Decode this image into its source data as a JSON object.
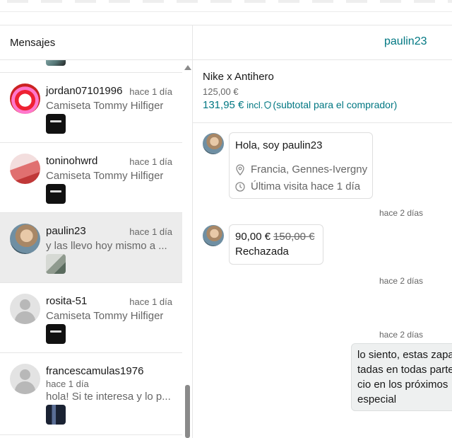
{
  "left_panel": {
    "title": "Mensajes",
    "conversations": [
      {
        "username": "jordan07101996",
        "time": "hace 1 día",
        "preview": "Camiseta Tommy Hilfiger",
        "avatar": "red-avatar",
        "thumb": "tshirt-thumb"
      },
      {
        "username": "toninohwrd",
        "time": "hace 1 día",
        "preview": "Camiseta Tommy Hilfiger",
        "avatar": "pink-avatar",
        "thumb": "tshirt-thumb"
      },
      {
        "username": "paulin23",
        "time": "hace 1 día",
        "preview": "y las llevo hoy mismo a ...",
        "avatar": "photo-avatar",
        "thumb": "shoes-thumb",
        "active": true
      },
      {
        "username": "rosita-51",
        "time": "hace 1 día",
        "preview": "Camiseta Tommy Hilfiger",
        "avatar": "default-avatar",
        "thumb": "tshirt-thumb"
      },
      {
        "username": "francescamulas1976",
        "time": "hace 1 día",
        "preview": "hola! Si te interesa y lo p...",
        "avatar": "default-avatar",
        "thumb": "coat-thumb"
      }
    ]
  },
  "right_panel": {
    "peer": "paulin23",
    "item": {
      "title": "Nike x Antihero",
      "price": "125,00 €",
      "total": "131,95 €",
      "total_incl": "incl.",
      "total_note": "(subtotal para el comprador)"
    },
    "messages": {
      "intro_title": "Hola, soy paulin23",
      "intro_location": "Francia, Gennes-Ivergny",
      "intro_last_seen": "Última visita hace 1 día",
      "stamp_1": "hace 2 días",
      "offer_amount": "90,00 €",
      "offer_original": "150,00 €",
      "offer_status": "Rechazada",
      "stamp_2": "hace 2 días",
      "stamp_3": "hace 2 días",
      "sent_lines": [
        "lo siento, estas zapa",
        "tadas en todas parte",
        "cio en los próximos ",
        "especial"
      ]
    }
  },
  "colors": {
    "accent": "#007782",
    "active_row": "#ececec",
    "muted": "#666666"
  }
}
